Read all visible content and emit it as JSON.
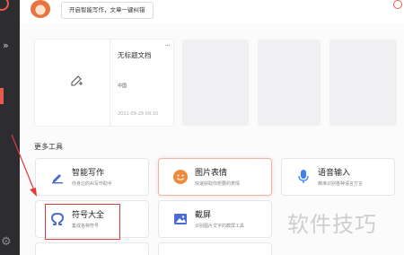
{
  "topbar": {
    "tip": "开启智能写作，文章一键纠错"
  },
  "documents": {
    "new_icon": "add-document-icon",
    "file": {
      "title": "无标题文档",
      "more": "...",
      "body": "中国",
      "date": "2021-09-29 09:10"
    }
  },
  "more_tools": {
    "heading": "更多工具",
    "tools": [
      {
        "name": "智能写作",
        "desc": "你身边的AI写作助手",
        "icon": "pen-icon",
        "color": "#4a6bd6"
      },
      {
        "name": "图片表情",
        "desc": "快速获取你想要的表情",
        "icon": "emoji-icon",
        "color": "#f08a3b"
      },
      {
        "name": "语音输入",
        "desc": "精准识别各种语言方言",
        "icon": "microphone-icon",
        "color": "#3b82f6"
      },
      {
        "name": "符号大全",
        "desc": "集成各种符号",
        "icon": "omega-icon",
        "color": "#4a6bd6"
      },
      {
        "name": "截屏",
        "desc": "识别图片文字的截屏工具",
        "icon": "screenshot-icon",
        "color": "#4a6bd6"
      }
    ]
  },
  "watermark": "软件技巧",
  "colors": {
    "accent": "#e95a4b",
    "highlight": "#e03a3a"
  }
}
